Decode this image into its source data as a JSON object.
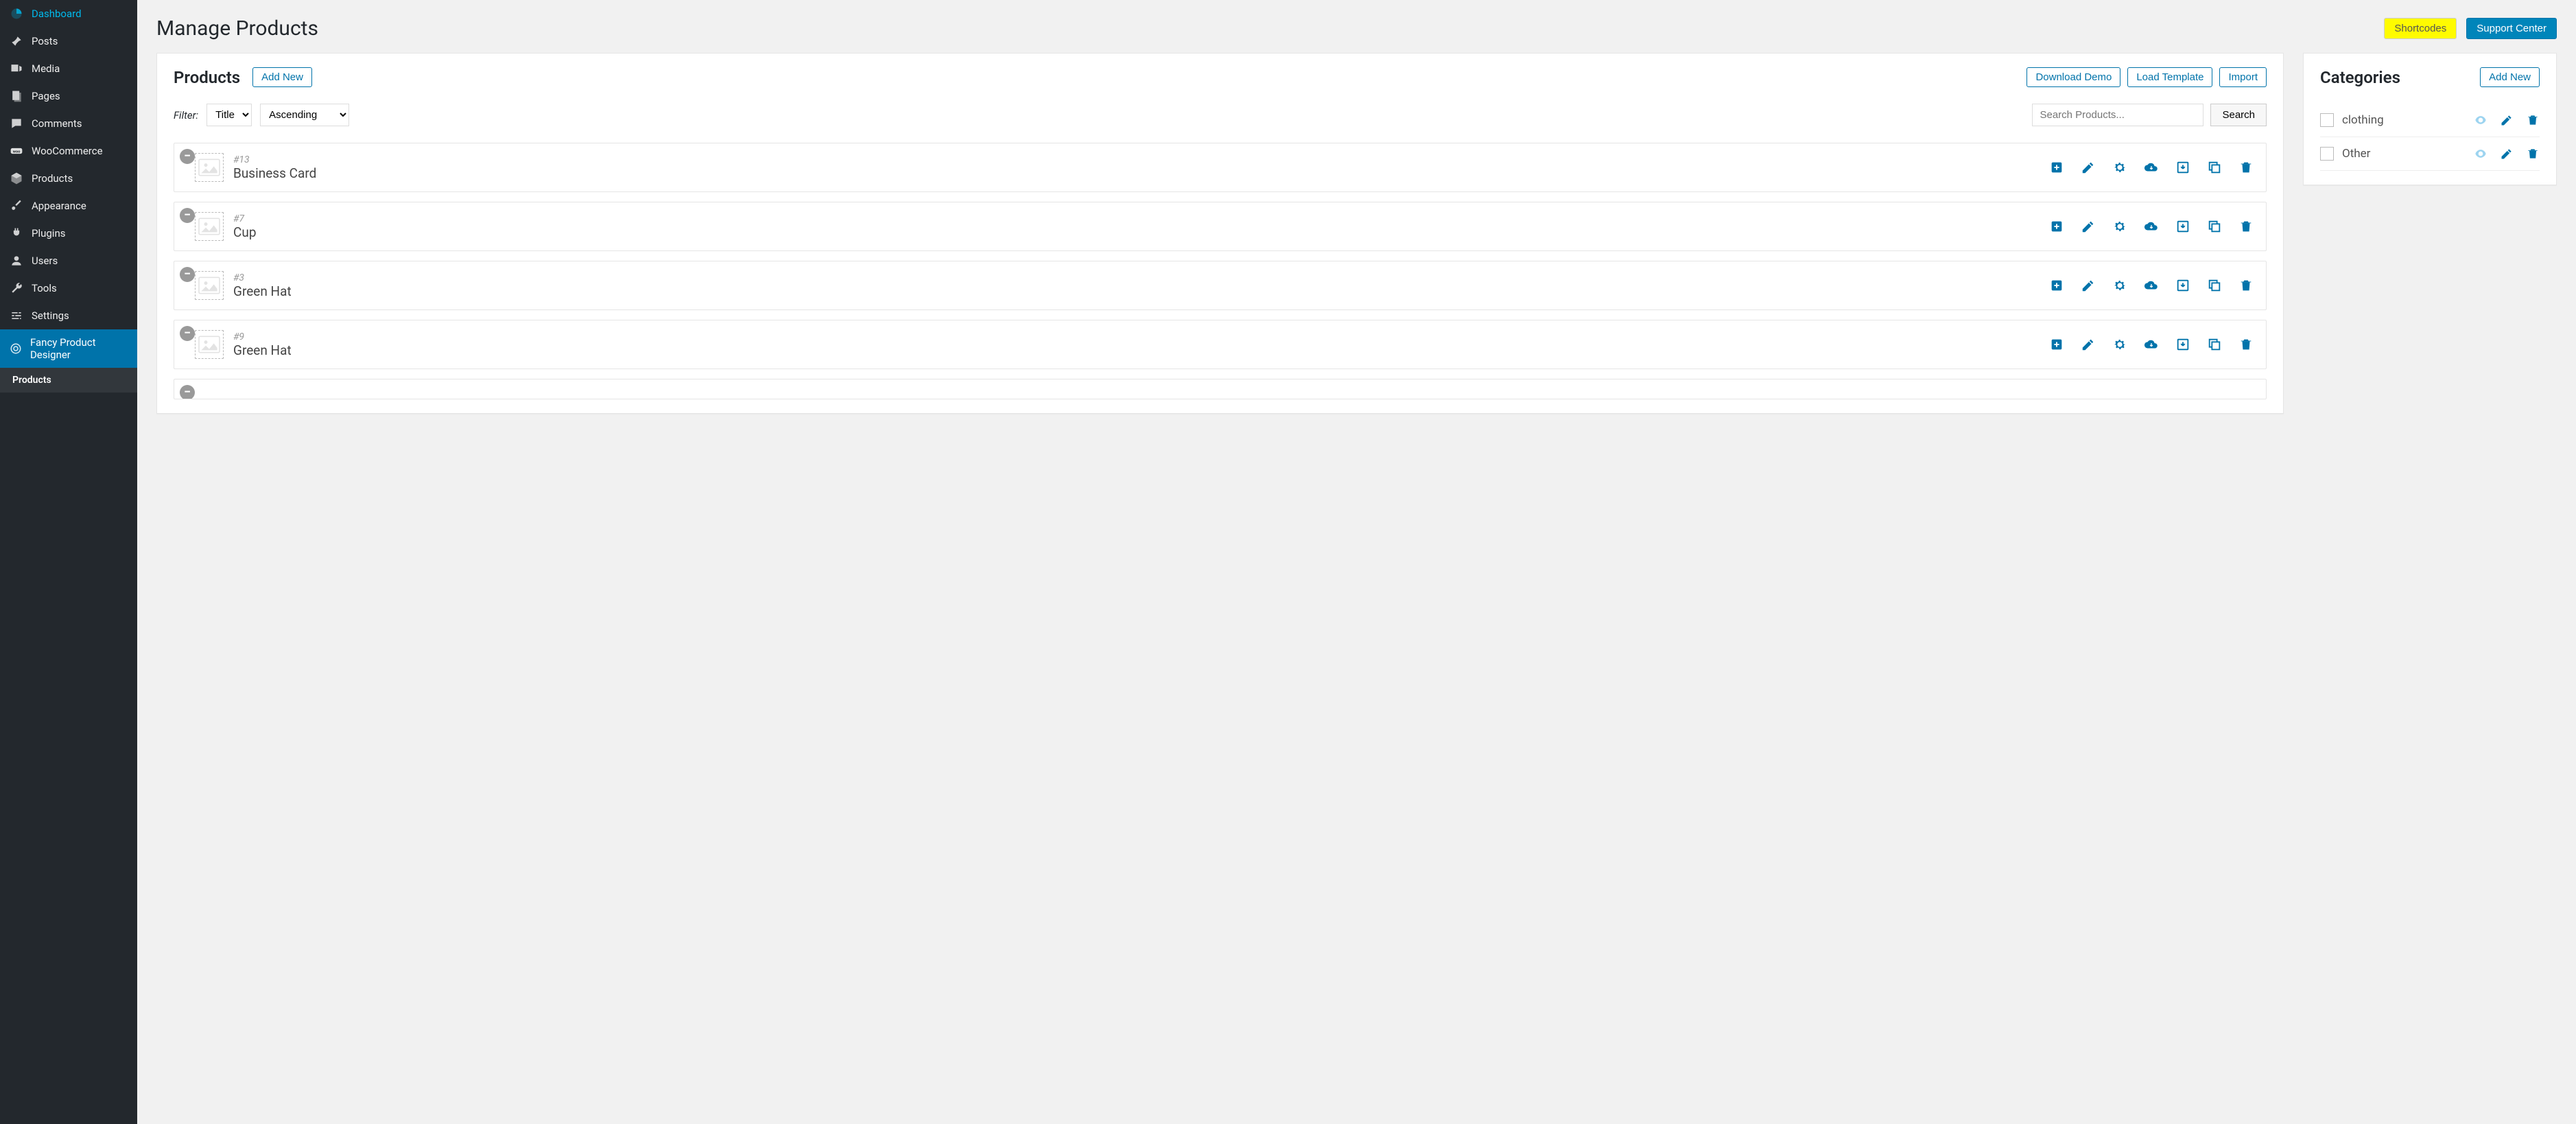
{
  "sidebar": {
    "items": [
      {
        "label": "Dashboard",
        "icon": "dashboard"
      },
      {
        "label": "Posts",
        "icon": "pin"
      },
      {
        "label": "Media",
        "icon": "media"
      },
      {
        "label": "Pages",
        "icon": "pages"
      },
      {
        "label": "Comments",
        "icon": "comment"
      },
      {
        "label": "WooCommerce",
        "icon": "woo"
      },
      {
        "label": "Products",
        "icon": "box"
      },
      {
        "label": "Appearance",
        "icon": "brush"
      },
      {
        "label": "Plugins",
        "icon": "plug"
      },
      {
        "label": "Users",
        "icon": "user"
      },
      {
        "label": "Tools",
        "icon": "wrench"
      },
      {
        "label": "Settings",
        "icon": "sliders"
      },
      {
        "label": "Fancy Product Designer",
        "icon": "target"
      }
    ],
    "submenu_label": "Products"
  },
  "page": {
    "title": "Manage Products",
    "shortcodes_btn": "Shortcodes",
    "support_btn": "Support Center"
  },
  "products_panel": {
    "title": "Products",
    "add_new": "Add New",
    "download_demo": "Download Demo",
    "load_template": "Load Template",
    "import": "Import",
    "filter_label": "Filter:",
    "filter_by": "Title",
    "filter_dir": "Ascending",
    "search_placeholder": "Search Products...",
    "search_btn": "Search",
    "items": [
      {
        "id": "#13",
        "name": "Business Card"
      },
      {
        "id": "#7",
        "name": "Cup"
      },
      {
        "id": "#3",
        "name": "Green Hat"
      },
      {
        "id": "#9",
        "name": "Green Hat"
      }
    ]
  },
  "categories_panel": {
    "title": "Categories",
    "add_new": "Add New",
    "items": [
      {
        "name": "clothing"
      },
      {
        "name": "Other"
      }
    ]
  }
}
